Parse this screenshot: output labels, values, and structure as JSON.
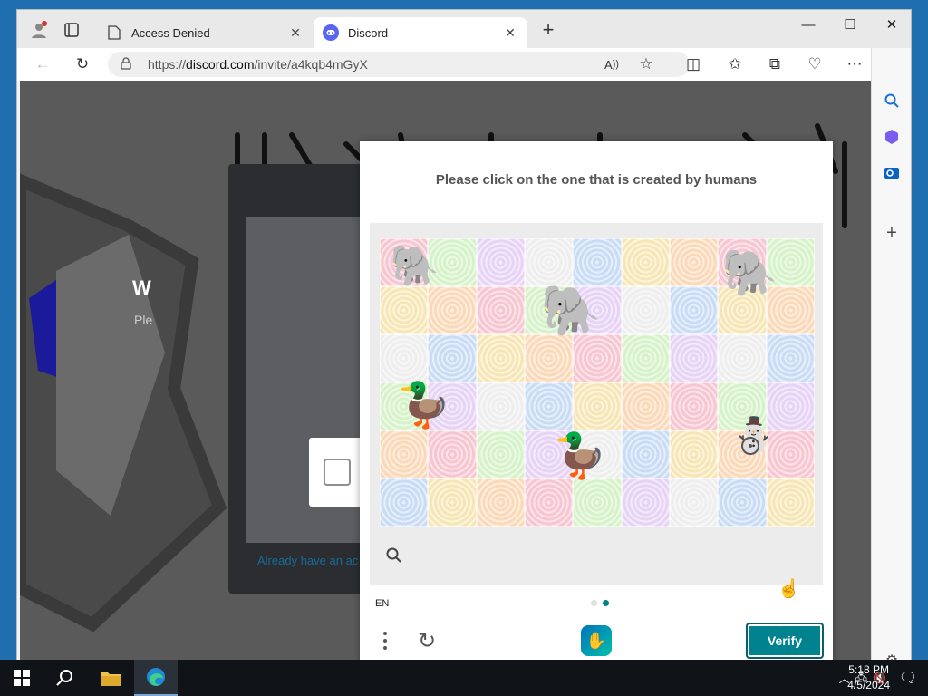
{
  "browser": {
    "tabs": [
      {
        "label": "Access Denied",
        "icon": "page-icon",
        "active": false
      },
      {
        "label": "Discord",
        "icon": "discord-icon",
        "active": true
      }
    ],
    "url_prefix": "https://",
    "url_host": "discord.com",
    "url_path": "/invite/a4kqb4mGyX"
  },
  "discord": {
    "heading_fragment": "W",
    "sub_fragment": "Ple",
    "link_fragment": "Already have an ac"
  },
  "captcha": {
    "prompt": "Please click on the one that is created by humans",
    "language": "EN",
    "verify_label": "Verify",
    "page_count": 2,
    "current_page": 2,
    "colors": {
      "accent": "#00838f"
    }
  },
  "taskbar": {
    "time": "5:18 PM",
    "date": "4/5/2024"
  }
}
